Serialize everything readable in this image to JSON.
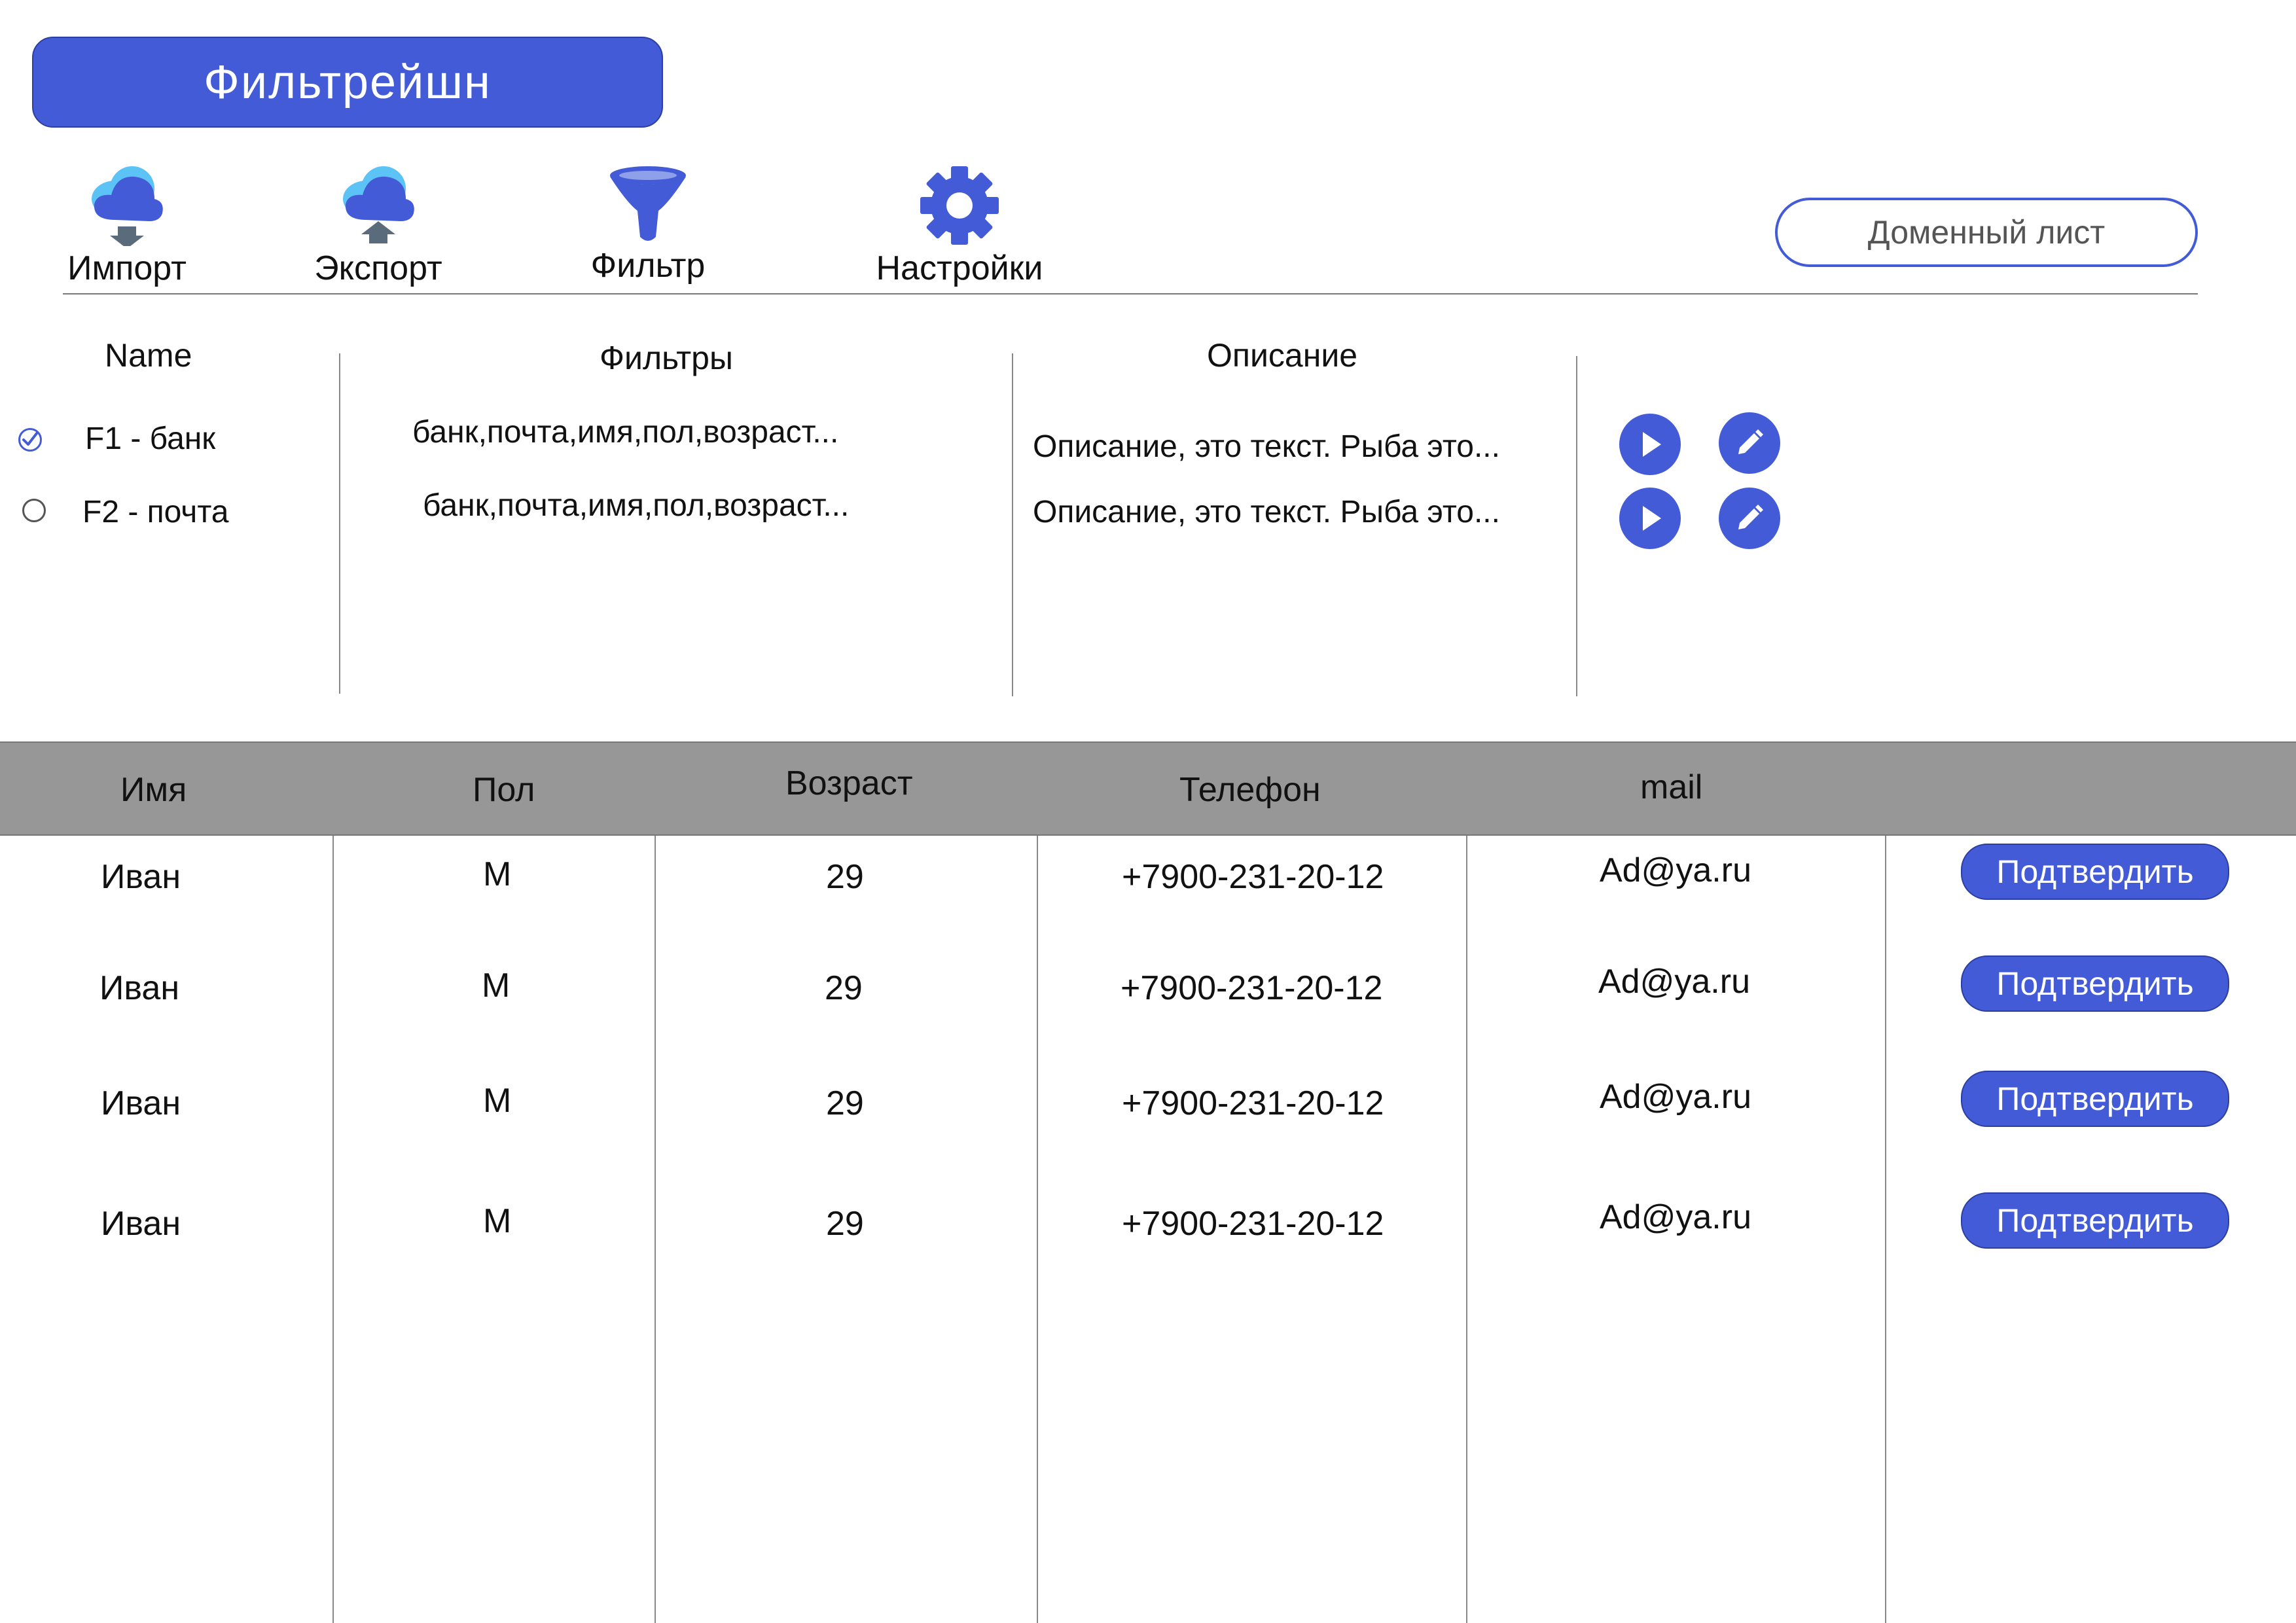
{
  "app": {
    "title": "Фильтрейшн"
  },
  "toolbar": {
    "items": [
      {
        "label": "Импорт",
        "icon": "cloud-download-icon"
      },
      {
        "label": "Экспорт",
        "icon": "cloud-upload-icon"
      },
      {
        "label": "Фильтр",
        "icon": "funnel-icon"
      },
      {
        "label": "Настройки",
        "icon": "gear-icon"
      }
    ],
    "domain_button": "Доменный лист"
  },
  "filters": {
    "headers": {
      "name": "Name",
      "filters": "Фильтры",
      "description": "Описание"
    },
    "rows": [
      {
        "name": "F1 - банк",
        "selected": true,
        "filters": "банк,почта,имя,пол,возраст...",
        "description": "Описание, это текст. Рыба это..."
      },
      {
        "name": "F2 - почта",
        "selected": false,
        "filters": "банк,почта,имя,пол,возраст...",
        "description": "Описание, это текст. Рыба это..."
      }
    ],
    "actions": {
      "run_icon": "play-icon",
      "edit_icon": "pencil-icon"
    }
  },
  "table": {
    "headers": [
      "Имя",
      "Пол",
      "Возраст",
      "Телефон",
      "mail"
    ],
    "rows": [
      {
        "name": "Иван",
        "sex": "М",
        "age": "29",
        "phone": "+7900-231-20-12",
        "mail": "Ad@ya.ru",
        "action": "Подтвердить"
      },
      {
        "name": "Иван",
        "sex": "М",
        "age": "29",
        "phone": "+7900-231-20-12",
        "mail": "Ad@ya.ru",
        "action": "Подтвердить"
      },
      {
        "name": "Иван",
        "sex": "М",
        "age": "29",
        "phone": "+7900-231-20-12",
        "mail": "Ad@ya.ru",
        "action": "Подтвердить"
      },
      {
        "name": "Иван",
        "sex": "М",
        "age": "29",
        "phone": "+7900-231-20-12",
        "mail": "Ad@ya.ru",
        "action": "Подтвердить"
      }
    ]
  },
  "colors": {
    "accent": "#435bd6",
    "header_bg": "#979797",
    "cloud_light": "#5cc3f7",
    "arrow": "#5a6b7b"
  }
}
